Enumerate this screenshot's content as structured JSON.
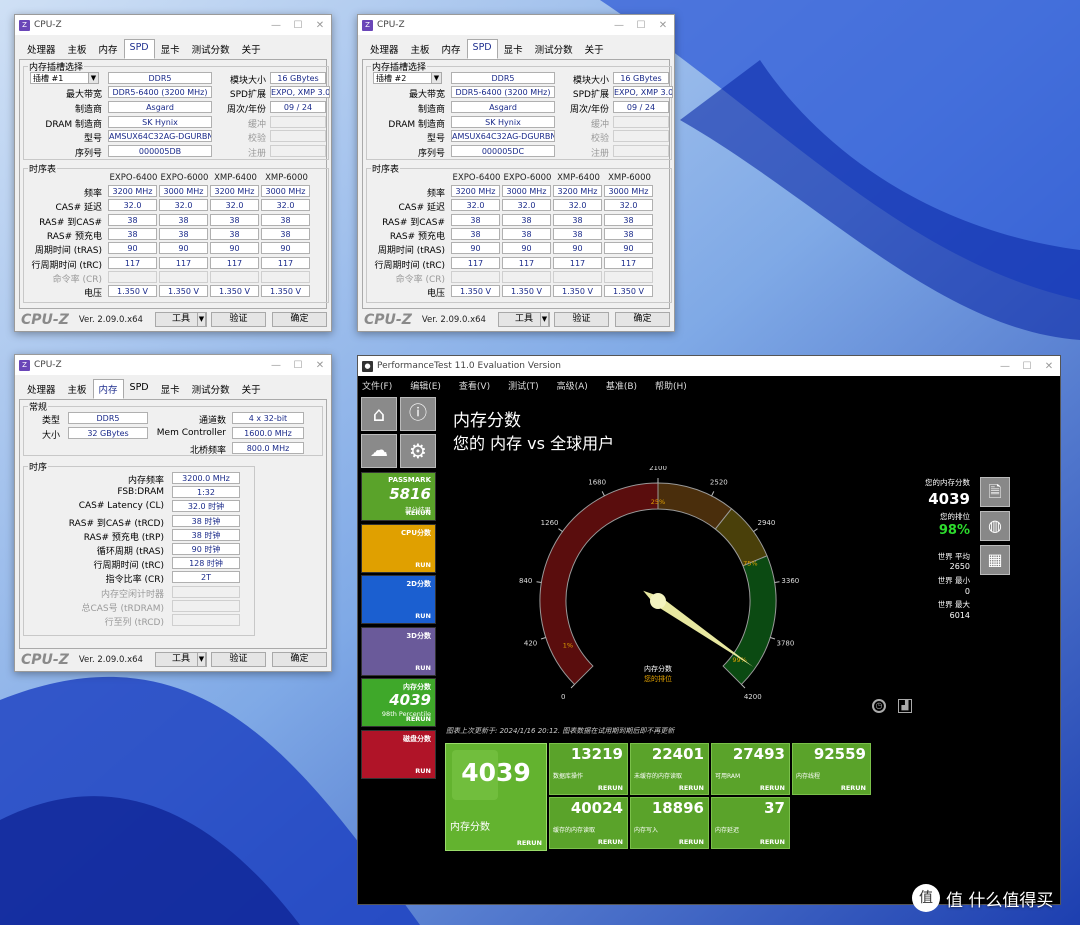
{
  "w1": {
    "title": "CPU-Z",
    "tabs": [
      "处理器",
      "主板",
      "内存",
      "SPD",
      "显卡",
      "测试分数",
      "关于"
    ],
    "active": 3,
    "slot_group": "内存插槽选择",
    "slot": "插槽 #1",
    "type": "DDR5",
    "module_size_label": "模块大小",
    "module_size": "16 GBytes",
    "max_bw_label": "最大带宽",
    "max_bw": "DDR5-6400 (3200 MHz)",
    "spd_ext_label": "SPD扩展",
    "spd_ext": "EXPO, XMP 3.0",
    "maker_label": "制造商",
    "maker": "Asgard",
    "week_label": "周次/年份",
    "week": "09 / 24",
    "dram_label": "DRAM 制造商",
    "dram": "SK Hynix",
    "buffer_label": "缓冲",
    "part_label": "型号",
    "part": "AMSUX64C32AG-DGURBN",
    "check_label": "校验",
    "serial_label": "序列号",
    "serial": "000005DB",
    "reg_label": "注册",
    "timings_group": "时序表",
    "cols": [
      "EXPO-6400",
      "EXPO-6000",
      "XMP-6400",
      "XMP-6000"
    ],
    "rows": [
      {
        "l": "频率",
        "v": [
          "3200 MHz",
          "3000 MHz",
          "3200 MHz",
          "3000 MHz"
        ]
      },
      {
        "l": "CAS# 延迟",
        "v": [
          "32.0",
          "32.0",
          "32.0",
          "32.0"
        ]
      },
      {
        "l": "RAS# 到CAS#",
        "v": [
          "38",
          "38",
          "38",
          "38"
        ]
      },
      {
        "l": "RAS# 预充电",
        "v": [
          "38",
          "38",
          "38",
          "38"
        ]
      },
      {
        "l": "周期时间 (tRAS)",
        "v": [
          "90",
          "90",
          "90",
          "90"
        ]
      },
      {
        "l": "行周期时间 (tRC)",
        "v": [
          "117",
          "117",
          "117",
          "117"
        ]
      },
      {
        "l": "命令率 (CR)",
        "v": [
          "",
          "",
          "",
          ""
        ],
        "g": true
      },
      {
        "l": "电压",
        "v": [
          "1.350 V",
          "1.350 V",
          "1.350 V",
          "1.350 V"
        ]
      }
    ],
    "logo": "CPU-Z",
    "ver": "Ver. 2.09.0.x64",
    "tools": "工具",
    "validate": "验证",
    "ok": "确定"
  },
  "w2": {
    "title": "CPU-Z",
    "slot": "插槽 #2",
    "serial": "000005DC"
  },
  "w3": {
    "title": "CPU-Z",
    "active": 2,
    "general": "常规",
    "type_label": "类型",
    "type": "DDR5",
    "channels_label": "通道数",
    "channels": "4 x 32-bit",
    "size_label": "大小",
    "size": "32 GBytes",
    "memctl_label": "Mem Controller",
    "memctl": "1600.0 MHz",
    "nb_label": "北桥频率",
    "nb": "800.0 MHz",
    "timing_group": "时序",
    "trows": [
      {
        "l": "内存频率",
        "v": "3200.0 MHz"
      },
      {
        "l": "FSB:DRAM",
        "v": "1:32"
      },
      {
        "l": "CAS# Latency (CL)",
        "v": "32.0 时钟"
      },
      {
        "l": "RAS# 到CAS# (tRCD)",
        "v": "38 时钟"
      },
      {
        "l": "RAS# 预充电 (tRP)",
        "v": "38 时钟"
      },
      {
        "l": "循环周期 (tRAS)",
        "v": "90 时钟"
      },
      {
        "l": "行周期时间 (tRC)",
        "v": "128 时钟"
      },
      {
        "l": "指令比率 (CR)",
        "v": "2T"
      },
      {
        "l": "内存空闲计时器",
        "v": "",
        "g": true
      },
      {
        "l": "总CAS号 (tRDRAM)",
        "v": "",
        "g": true
      },
      {
        "l": "行至列 (tRCD)",
        "v": "",
        "g": true
      }
    ]
  },
  "pt": {
    "title": "PerformanceTest 11.0 Evaluation Version",
    "menu": [
      "文件(F)",
      "编辑(E)",
      "查看(V)",
      "测试(T)",
      "高级(A)",
      "基准(B)",
      "帮助(H)"
    ],
    "heading": "内存分数",
    "sub": "您的 内存 vs 全球用户",
    "tiles": [
      {
        "n": "PASSMARK",
        "score": "5816",
        "sub": "部分结果",
        "r": "RERUN",
        "c": "#5aa32a"
      },
      {
        "n": "CPU分数",
        "r": "RUN",
        "c": "#e0a000"
      },
      {
        "n": "2D分数",
        "r": "RUN",
        "c": "#1b5fd0"
      },
      {
        "n": "3D分数",
        "r": "RUN",
        "c": "#6a5a9a"
      },
      {
        "n": "内存分数",
        "score": "4039",
        "sub": "98th Percentile",
        "r": "RERUN",
        "c": "#3fa82a"
      },
      {
        "n": "磁盘分数",
        "r": "RUN",
        "c": "#b01428"
      }
    ],
    "gauge_ticks": [
      "0",
      "420",
      "840",
      "1260",
      "1680",
      "2100",
      "2520",
      "2940",
      "3360",
      "3780",
      "4200"
    ],
    "gauge_pct": [
      "1%",
      "25%",
      "75%",
      "99%"
    ],
    "gauge_l1": "内存分数",
    "gauge_l2": "您的排位",
    "gauge_value": 4039,
    "gauge_max": 4200,
    "side": {
      "score_label": "您的内存分数",
      "score": "4039",
      "rank_label": "您的排位",
      "rank": "98%",
      "avg_label": "世界 平均",
      "avg": "2650",
      "min_label": "世界 最小",
      "min": "0",
      "max_label": "世界 最大",
      "max": "6014"
    },
    "note": "图表上次更新于: 2024/1/16 20:12. 图表数据在试用期到期后即不再更新",
    "big": {
      "v": "4039",
      "l": "内存分数",
      "r": "RERUN"
    },
    "res": [
      {
        "v": "13219",
        "d": "数据库操作"
      },
      {
        "v": "22401",
        "d": "未缓存的内存读取"
      },
      {
        "v": "27493",
        "d": "可用RAM"
      },
      {
        "v": "92559",
        "d": "内存线程"
      },
      {
        "v": "40024",
        "d": "缓存的内存读取"
      },
      {
        "v": "18896",
        "d": "内存写入"
      },
      {
        "v": "37",
        "d": "内存延迟"
      }
    ],
    "rerun": "RERUN"
  },
  "wm": "值 什么值得买"
}
